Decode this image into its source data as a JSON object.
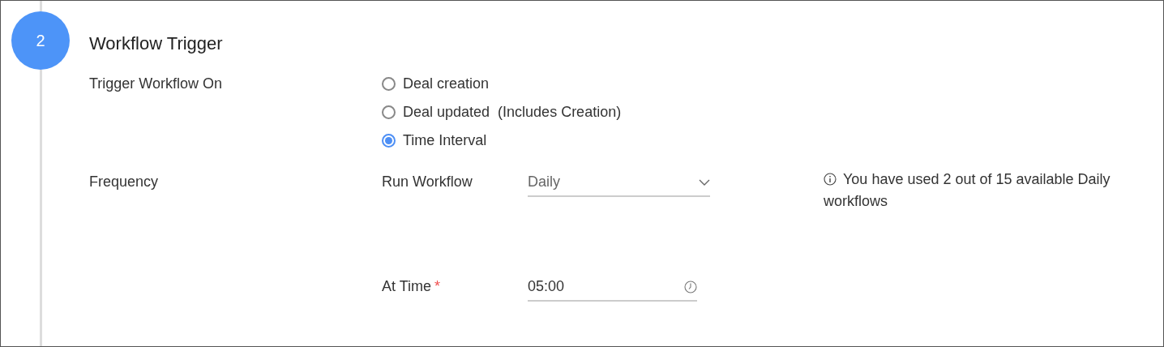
{
  "step": {
    "number": "2",
    "title": "Workflow Trigger"
  },
  "trigger": {
    "label": "Trigger Workflow On",
    "options": [
      {
        "label": "Deal creation",
        "selected": false
      },
      {
        "label": "Deal updated  (Includes Creation)",
        "selected": false
      },
      {
        "label": "Time Interval",
        "selected": true
      }
    ]
  },
  "frequency": {
    "label": "Frequency",
    "run_workflow": {
      "label": "Run Workflow",
      "value": "Daily"
    },
    "info": "You have used 2 out of 15 available Daily workflows",
    "at_time": {
      "label": "At Time",
      "required_mark": "*",
      "value": "05:00"
    }
  }
}
